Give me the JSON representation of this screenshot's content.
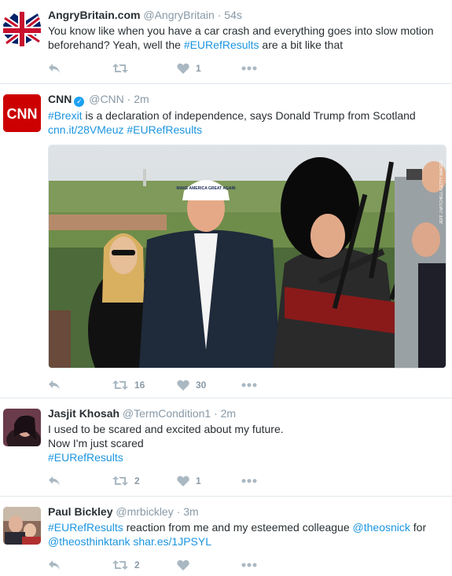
{
  "tweets": [
    {
      "name": "AngryBritain.com",
      "handle": "@AngryBritain",
      "time": "54s",
      "avatar": "union-jack-avatar",
      "lines": [
        "You know like when you have a car crash and everything goes into slow motion",
        "beforehand? Yeah, well the "
      ],
      "hashtag": "#EURefResults",
      "tail": " are a bit like that",
      "retweets": "",
      "likes": "1"
    },
    {
      "name": "CNN",
      "handle": "@CNN",
      "time": "2m",
      "verified": true,
      "avatar": "cnn-logo-avatar",
      "avatar_text": "CNN",
      "hashtag_brexit": "#Brexit",
      "line1": " is a declaration of independence, says Donald Trump from Scotland",
      "url": "cnn.it/28VMeuz",
      "hashtag": "#EURefResults",
      "media_credit": "JEFF J MITCHELL/GETTY IMAGES",
      "hat_text": "MAKE AMERICA GREAT AGAIN",
      "retweets": "16",
      "likes": "30"
    },
    {
      "name": "Jasjit Khosah",
      "handle": "@TermCondition1",
      "time": "2m",
      "avatar": "profile-photo-avatar",
      "line1": "I used to be scared and excited about my future.",
      "line2": "Now I'm just scared",
      "hashtag": "#EURefResults",
      "retweets": "2",
      "likes": "1"
    },
    {
      "name": "Paul Bickley",
      "handle": "@mrbickley",
      "time": "3m",
      "avatar": "profile-photo-avatar",
      "hashtag": "#EURefResults",
      "line1_mid": " reaction from me and my esteemed colleague ",
      "mention1": "@theosnick",
      "line1_end": " for",
      "mention2": "@theosthinktank",
      "url": "shar.es/1JPSYL",
      "retweets": "2",
      "likes": ""
    }
  ],
  "colors": {
    "link": "#1b95e0",
    "muted": "#8899a6",
    "text": "#292f33",
    "verified": "#1da1f2",
    "cnn_red": "#cc0000"
  }
}
